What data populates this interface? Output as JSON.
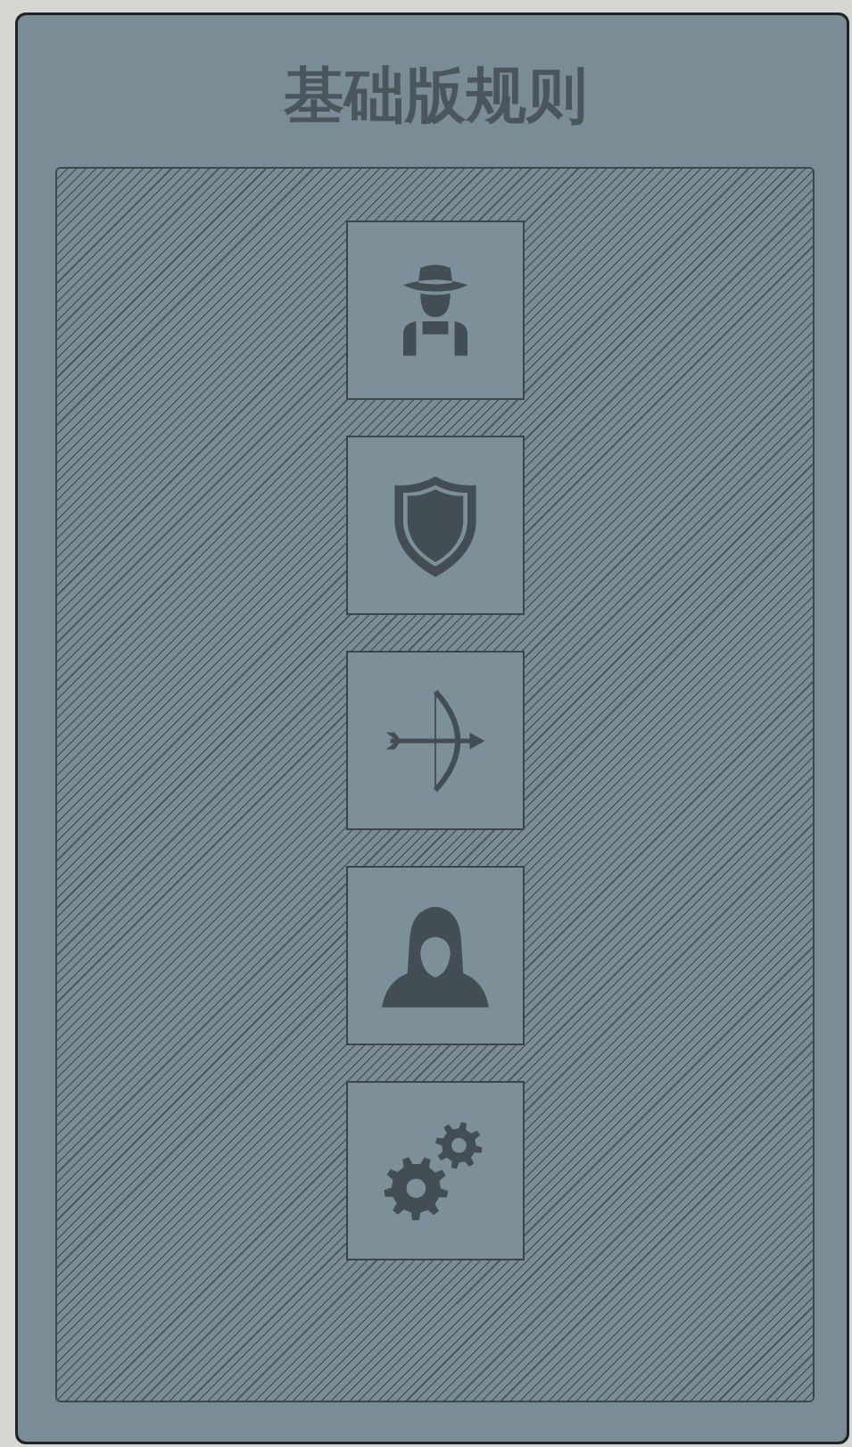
{
  "title": "基础版规则",
  "buttons": [
    {
      "kind": "farmer"
    },
    {
      "kind": "shield"
    },
    {
      "kind": "bow"
    },
    {
      "kind": "hooded"
    },
    {
      "kind": "gears"
    }
  ]
}
